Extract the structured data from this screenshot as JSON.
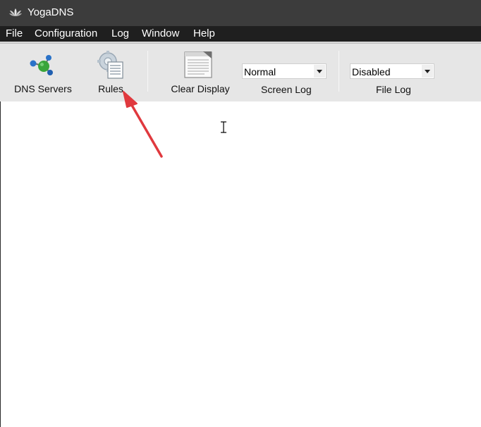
{
  "window": {
    "title": "YogaDNS",
    "app_icon": "lotus-icon"
  },
  "menu": {
    "items": [
      "File",
      "Configuration",
      "Log",
      "Window",
      "Help"
    ]
  },
  "toolbar": {
    "dns_servers_label": "DNS Servers",
    "rules_label": "Rules",
    "clear_display_label": "Clear Display",
    "screen_log": {
      "label": "Screen Log",
      "value": "Normal"
    },
    "file_log": {
      "label": "File Log",
      "value": "Disabled"
    }
  },
  "colors": {
    "titlebar": "#3c3c3c",
    "menubar": "#1f1f1f",
    "toolbar": "#e6e6e6",
    "annotation_arrow": "#e0393e"
  }
}
